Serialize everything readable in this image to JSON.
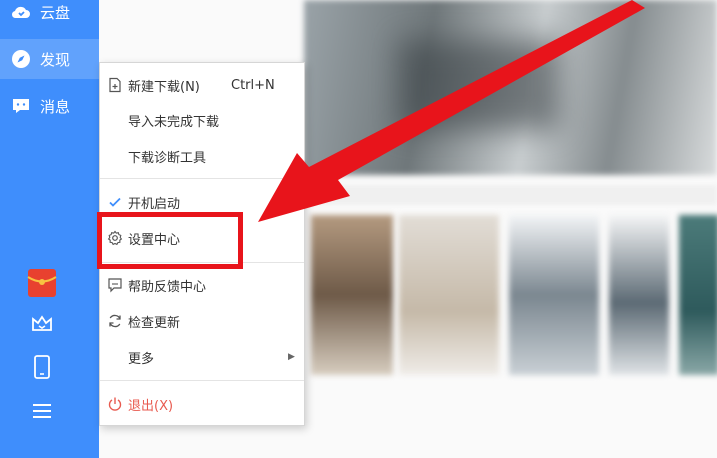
{
  "sidebar": {
    "items": [
      {
        "label": "云盘",
        "icon": "cloud-icon"
      },
      {
        "label": "发现",
        "icon": "compass-icon",
        "active": true
      },
      {
        "label": "消息",
        "icon": "message-icon"
      }
    ],
    "bottom_icons": [
      "red-envelope-icon",
      "crown-icon",
      "phone-icon",
      "hamburger-menu-icon"
    ]
  },
  "menu": {
    "new_download": {
      "label": "新建下载(N)",
      "shortcut": "Ctrl+N"
    },
    "import_unfinished": "导入未完成下载",
    "diagnose_tool": "下载诊断工具",
    "autostart": {
      "label": "开机启动",
      "checked": true
    },
    "settings_center": "设置中心",
    "help_feedback": "帮助反馈中心",
    "check_update": "检查更新",
    "more": "更多",
    "quit": "退出(X)"
  },
  "colors": {
    "sidebar": "#3f8efc",
    "highlight_annotation": "#e8141b",
    "quit_text": "#e85a4f",
    "check_mark": "#3f8efc"
  }
}
